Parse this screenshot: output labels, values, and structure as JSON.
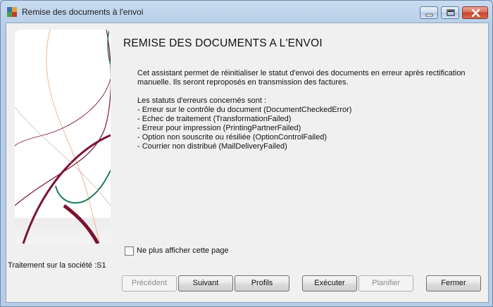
{
  "window": {
    "title": "Remise des documents à l'envoi",
    "controls": [
      "minimize-icon",
      "maximize-icon",
      "close-icon"
    ]
  },
  "main": {
    "heading": "REMISE DES DOCUMENTS A L'ENVOI",
    "description_line1": "Cet assistant permet de réinitialiser le statut d'envoi des documents en erreur après rectification",
    "description_line2": "manuelle. Ils seront reproposés en transmission des factures.",
    "status_title": "Les statuts d'erreurs concernés sont :",
    "statuses": [
      "- Erreur sur le contrôle du document (DocumentCheckedError)",
      "- Echec de traitement (TransformationFailed)",
      "- Erreur pour impression (PrintingPartnerFailed)",
      "- Option non souscrite ou résiliée (OptionControlFailed)",
      "- Courrier non distribué (MailDeliveryFailed)"
    ],
    "checkbox_label": "Ne plus afficher cette page",
    "checkbox_checked": false
  },
  "footer": {
    "company_label": "Traitement sur la société :S1",
    "buttons": {
      "previous": "Précédent",
      "next": "Suivant",
      "profiles": "Profils",
      "execute": "Exécuter",
      "schedule": "Planifier",
      "close": "Fermer"
    }
  },
  "colors": {
    "title_bar": "#b9d1ea",
    "dialog_bg": "#f0f0f0",
    "art_dark_red": "#7b1230",
    "art_green": "#1f7a5a",
    "art_peach": "#f2b48f"
  }
}
